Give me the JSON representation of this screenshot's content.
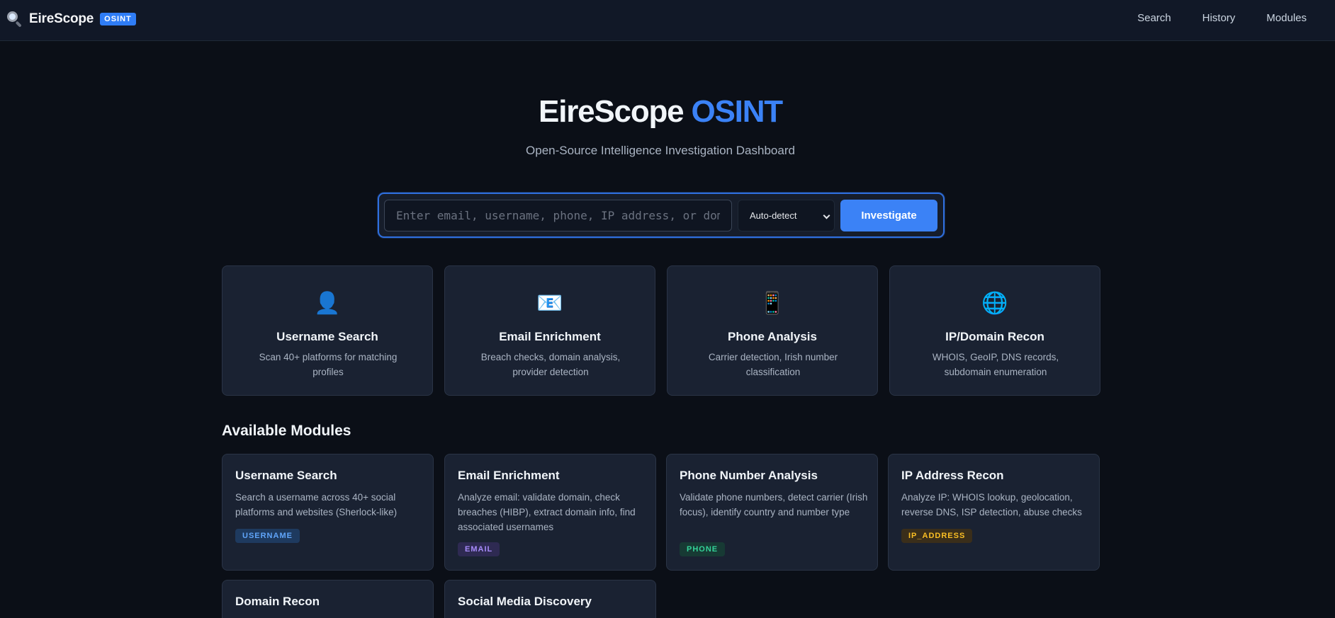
{
  "header": {
    "brand_name": "EireScope",
    "brand_badge": "OSINT",
    "brand_icon": "magnifier-icon",
    "nav": [
      "Search",
      "History",
      "Modules"
    ]
  },
  "hero": {
    "title_main": "EireScope",
    "title_accent": "OSINT",
    "subtitle": "Open-Source Intelligence Investigation Dashboard"
  },
  "search": {
    "placeholder": "Enter email, username, phone, IP address, or domain",
    "value": "",
    "type_selected": "Auto-detect",
    "button_label": "Investigate"
  },
  "features": [
    {
      "icon": "👤",
      "icon_name": "user-silhouette-icon",
      "title": "Username Search",
      "desc": "Scan 40+ platforms for matching profiles"
    },
    {
      "icon": "📧",
      "icon_name": "email-icon",
      "title": "Email Enrichment",
      "desc": "Breach checks, domain analysis, provider detection"
    },
    {
      "icon": "📱",
      "icon_name": "mobile-phone-icon",
      "title": "Phone Analysis",
      "desc": "Carrier detection, Irish number classification"
    },
    {
      "icon": "🌐",
      "icon_name": "globe-icon",
      "title": "IP/Domain Recon",
      "desc": "WHOIS, GeoIP, DNS records, subdomain enumeration"
    }
  ],
  "modules_section": {
    "title": "Available Modules",
    "modules": [
      {
        "title": "Username Search",
        "desc": "Search a username across 40+ social platforms and websites (Sherlock-like)",
        "tag": "USERNAME"
      },
      {
        "title": "Email Enrichment",
        "desc": "Analyze email: validate domain, check breaches (HIBP), extract domain info, find associated usernames",
        "tag": "EMAIL"
      },
      {
        "title": "Phone Number Analysis",
        "desc": "Validate phone numbers, detect carrier (Irish focus), identify country and number type",
        "tag": "PHONE"
      },
      {
        "title": "IP Address Recon",
        "desc": "Analyze IP: WHOIS lookup, geolocation, reverse DNS, ISP detection, abuse checks",
        "tag": "IP_ADDRESS"
      },
      {
        "title": "Domain Recon"
      },
      {
        "title": "Social Media Discovery"
      }
    ]
  },
  "colors": {
    "background": "#0b0f17",
    "topbar": "#111827",
    "card": "#1a2232",
    "accent": "#3b82f6"
  }
}
